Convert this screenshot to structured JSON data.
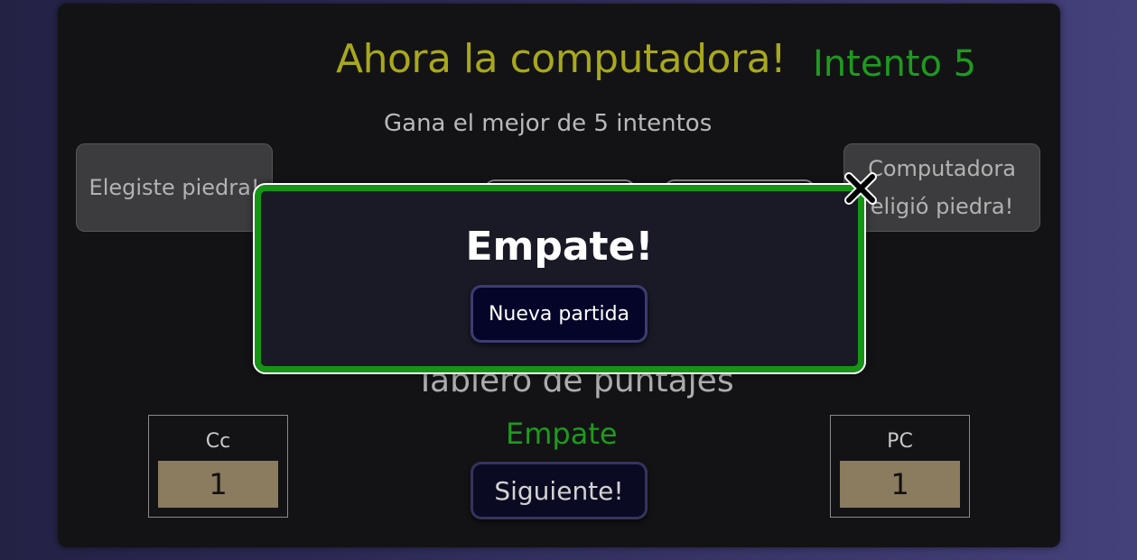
{
  "header": {
    "title": "Ahora la computadora!",
    "attempt": "Intento 5",
    "subtitle": "Gana el mejor de 5 intentos"
  },
  "choices": {
    "player": "Elegiste piedra!",
    "computer": "Computadora eligió piedra!"
  },
  "scoreboard": {
    "title": "Tablero de puntajes",
    "result": "Empate",
    "next_label": "Siguiente!",
    "player": {
      "name": "Cc",
      "score": "1"
    },
    "computer": {
      "name": "PC",
      "score": "1"
    }
  },
  "modal": {
    "title": "Empate!",
    "button_label": "Nueva partida",
    "close_icon": "close-icon"
  },
  "colors": {
    "title": "#a8a81c",
    "attempt": "#1e9a1e",
    "modal_border": "#169416",
    "score_bg": "#8b7b5f"
  }
}
